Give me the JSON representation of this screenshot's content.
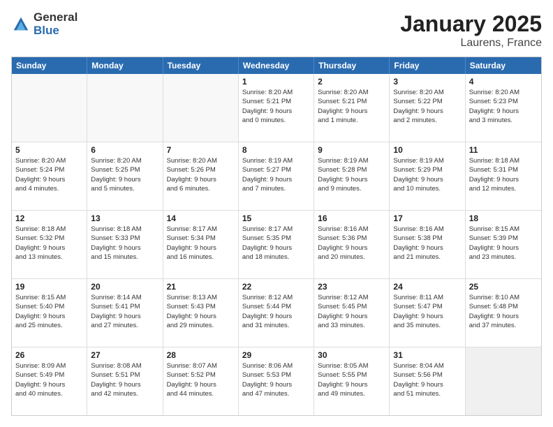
{
  "header": {
    "logo_general": "General",
    "logo_blue": "Blue",
    "month": "January 2025",
    "location": "Laurens, France"
  },
  "days_of_week": [
    "Sunday",
    "Monday",
    "Tuesday",
    "Wednesday",
    "Thursday",
    "Friday",
    "Saturday"
  ],
  "weeks": [
    [
      {
        "day": "",
        "info": ""
      },
      {
        "day": "",
        "info": ""
      },
      {
        "day": "",
        "info": ""
      },
      {
        "day": "1",
        "info": "Sunrise: 8:20 AM\nSunset: 5:21 PM\nDaylight: 9 hours\nand 0 minutes."
      },
      {
        "day": "2",
        "info": "Sunrise: 8:20 AM\nSunset: 5:21 PM\nDaylight: 9 hours\nand 1 minute."
      },
      {
        "day": "3",
        "info": "Sunrise: 8:20 AM\nSunset: 5:22 PM\nDaylight: 9 hours\nand 2 minutes."
      },
      {
        "day": "4",
        "info": "Sunrise: 8:20 AM\nSunset: 5:23 PM\nDaylight: 9 hours\nand 3 minutes."
      }
    ],
    [
      {
        "day": "5",
        "info": "Sunrise: 8:20 AM\nSunset: 5:24 PM\nDaylight: 9 hours\nand 4 minutes."
      },
      {
        "day": "6",
        "info": "Sunrise: 8:20 AM\nSunset: 5:25 PM\nDaylight: 9 hours\nand 5 minutes."
      },
      {
        "day": "7",
        "info": "Sunrise: 8:20 AM\nSunset: 5:26 PM\nDaylight: 9 hours\nand 6 minutes."
      },
      {
        "day": "8",
        "info": "Sunrise: 8:19 AM\nSunset: 5:27 PM\nDaylight: 9 hours\nand 7 minutes."
      },
      {
        "day": "9",
        "info": "Sunrise: 8:19 AM\nSunset: 5:28 PM\nDaylight: 9 hours\nand 9 minutes."
      },
      {
        "day": "10",
        "info": "Sunrise: 8:19 AM\nSunset: 5:29 PM\nDaylight: 9 hours\nand 10 minutes."
      },
      {
        "day": "11",
        "info": "Sunrise: 8:18 AM\nSunset: 5:31 PM\nDaylight: 9 hours\nand 12 minutes."
      }
    ],
    [
      {
        "day": "12",
        "info": "Sunrise: 8:18 AM\nSunset: 5:32 PM\nDaylight: 9 hours\nand 13 minutes."
      },
      {
        "day": "13",
        "info": "Sunrise: 8:18 AM\nSunset: 5:33 PM\nDaylight: 9 hours\nand 15 minutes."
      },
      {
        "day": "14",
        "info": "Sunrise: 8:17 AM\nSunset: 5:34 PM\nDaylight: 9 hours\nand 16 minutes."
      },
      {
        "day": "15",
        "info": "Sunrise: 8:17 AM\nSunset: 5:35 PM\nDaylight: 9 hours\nand 18 minutes."
      },
      {
        "day": "16",
        "info": "Sunrise: 8:16 AM\nSunset: 5:36 PM\nDaylight: 9 hours\nand 20 minutes."
      },
      {
        "day": "17",
        "info": "Sunrise: 8:16 AM\nSunset: 5:38 PM\nDaylight: 9 hours\nand 21 minutes."
      },
      {
        "day": "18",
        "info": "Sunrise: 8:15 AM\nSunset: 5:39 PM\nDaylight: 9 hours\nand 23 minutes."
      }
    ],
    [
      {
        "day": "19",
        "info": "Sunrise: 8:15 AM\nSunset: 5:40 PM\nDaylight: 9 hours\nand 25 minutes."
      },
      {
        "day": "20",
        "info": "Sunrise: 8:14 AM\nSunset: 5:41 PM\nDaylight: 9 hours\nand 27 minutes."
      },
      {
        "day": "21",
        "info": "Sunrise: 8:13 AM\nSunset: 5:43 PM\nDaylight: 9 hours\nand 29 minutes."
      },
      {
        "day": "22",
        "info": "Sunrise: 8:12 AM\nSunset: 5:44 PM\nDaylight: 9 hours\nand 31 minutes."
      },
      {
        "day": "23",
        "info": "Sunrise: 8:12 AM\nSunset: 5:45 PM\nDaylight: 9 hours\nand 33 minutes."
      },
      {
        "day": "24",
        "info": "Sunrise: 8:11 AM\nSunset: 5:47 PM\nDaylight: 9 hours\nand 35 minutes."
      },
      {
        "day": "25",
        "info": "Sunrise: 8:10 AM\nSunset: 5:48 PM\nDaylight: 9 hours\nand 37 minutes."
      }
    ],
    [
      {
        "day": "26",
        "info": "Sunrise: 8:09 AM\nSunset: 5:49 PM\nDaylight: 9 hours\nand 40 minutes."
      },
      {
        "day": "27",
        "info": "Sunrise: 8:08 AM\nSunset: 5:51 PM\nDaylight: 9 hours\nand 42 minutes."
      },
      {
        "day": "28",
        "info": "Sunrise: 8:07 AM\nSunset: 5:52 PM\nDaylight: 9 hours\nand 44 minutes."
      },
      {
        "day": "29",
        "info": "Sunrise: 8:06 AM\nSunset: 5:53 PM\nDaylight: 9 hours\nand 47 minutes."
      },
      {
        "day": "30",
        "info": "Sunrise: 8:05 AM\nSunset: 5:55 PM\nDaylight: 9 hours\nand 49 minutes."
      },
      {
        "day": "31",
        "info": "Sunrise: 8:04 AM\nSunset: 5:56 PM\nDaylight: 9 hours\nand 51 minutes."
      },
      {
        "day": "",
        "info": ""
      }
    ]
  ]
}
